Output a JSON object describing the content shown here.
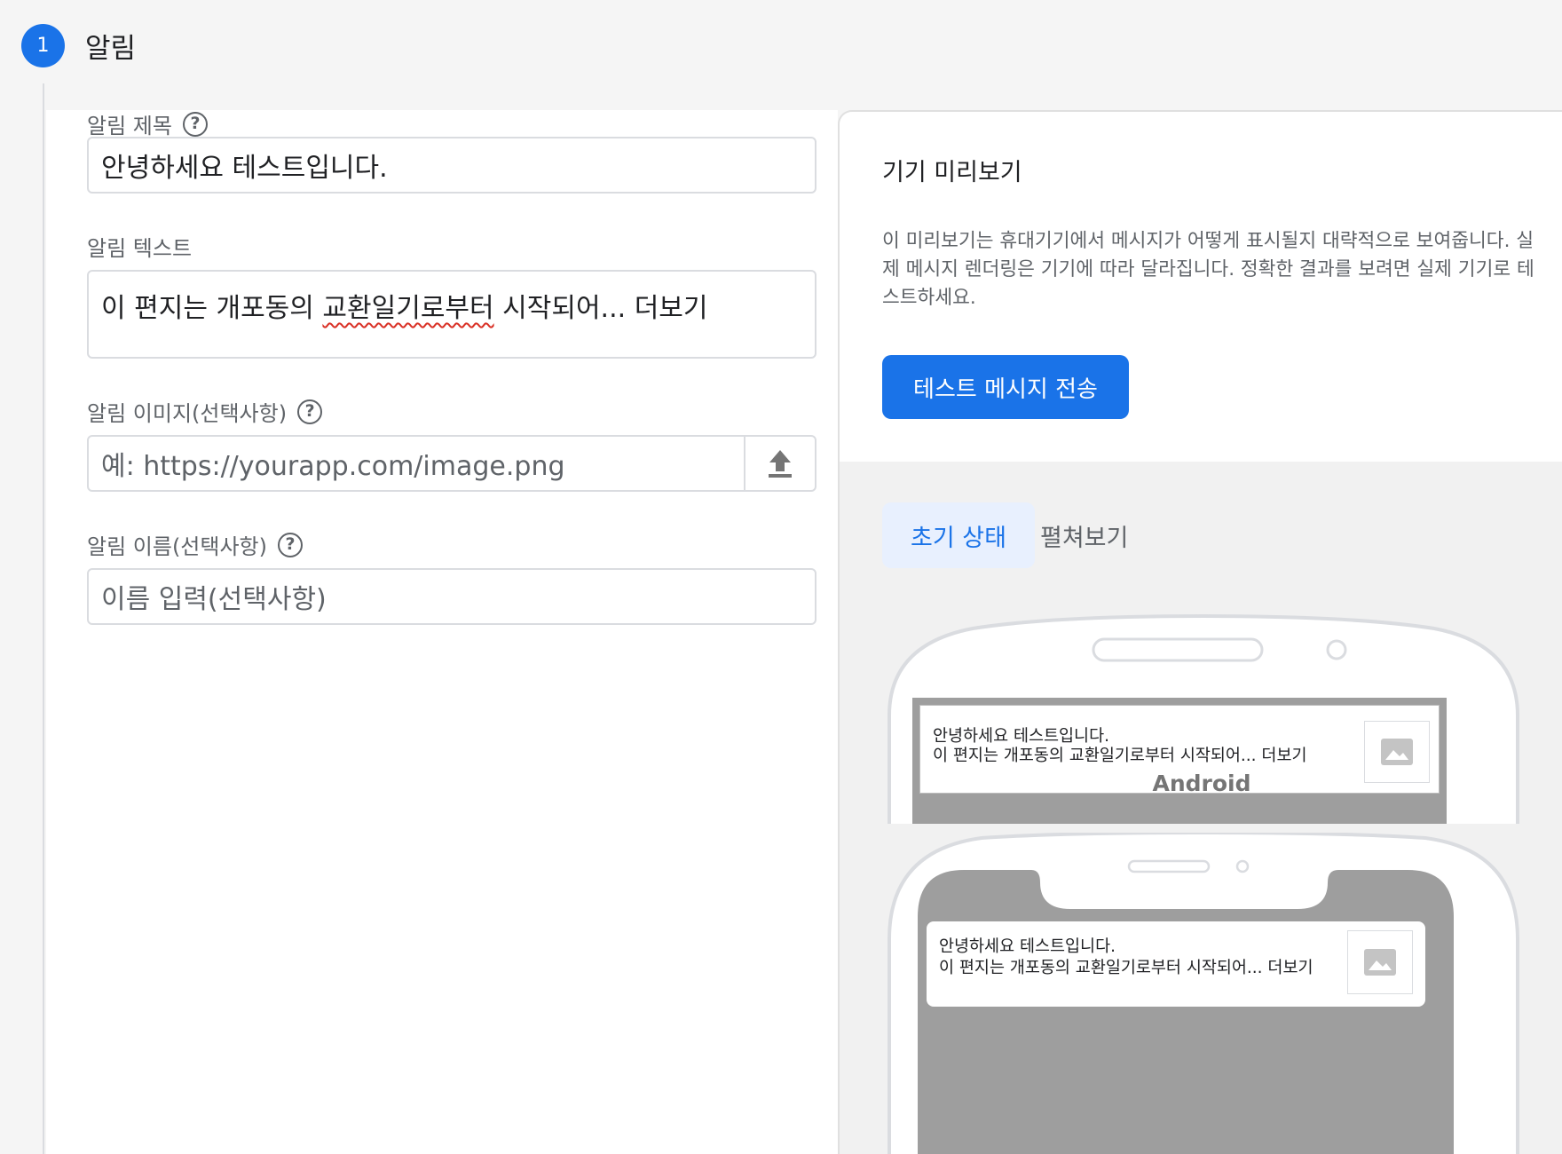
{
  "step": {
    "number": "1",
    "title": "알림"
  },
  "form": {
    "title_label": "알림 제목",
    "title_value": "안녕하세요 테스트입니다.",
    "text_label": "알림 텍스트",
    "text_value_before": "이 편지는 개포동의 ",
    "text_value_misspelled": "교환일기로부터",
    "text_value_after": " 시작되어... 더보기",
    "image_label": "알림 이미지(선택사항)",
    "image_placeholder": "예: https://yourapp.com/image.png",
    "name_label": "알림 이름(선택사항)",
    "name_placeholder": "이름 입력(선택사항)"
  },
  "preview": {
    "title": "기기 미리보기",
    "description": "이 미리보기는 휴대기기에서 메시지가 어떻게 표시될지 대략적으로 보여줍니다. 실제 메시지 렌더링은 기기에 따라 달라집니다. 정확한 결과를 보려면 실제 기기로 테스트하세요.",
    "send_button": "테스트 메시지 전송",
    "tabs": [
      {
        "label": "초기 상태",
        "active": true
      },
      {
        "label": "펼쳐보기",
        "active": false
      }
    ],
    "device_label": "Android",
    "notification": {
      "title": "안녕하세요 테스트입니다.",
      "body": "이 편지는 개포동의 교환일기로부터 시작되어... 더보기"
    }
  },
  "colors": {
    "accent": "#1a73e8",
    "tab_active_bg": "#e8f0fe",
    "error_underline": "#d93025"
  },
  "icons": {
    "help": "help-circle-icon",
    "upload": "upload-icon",
    "image": "image-placeholder-icon"
  }
}
